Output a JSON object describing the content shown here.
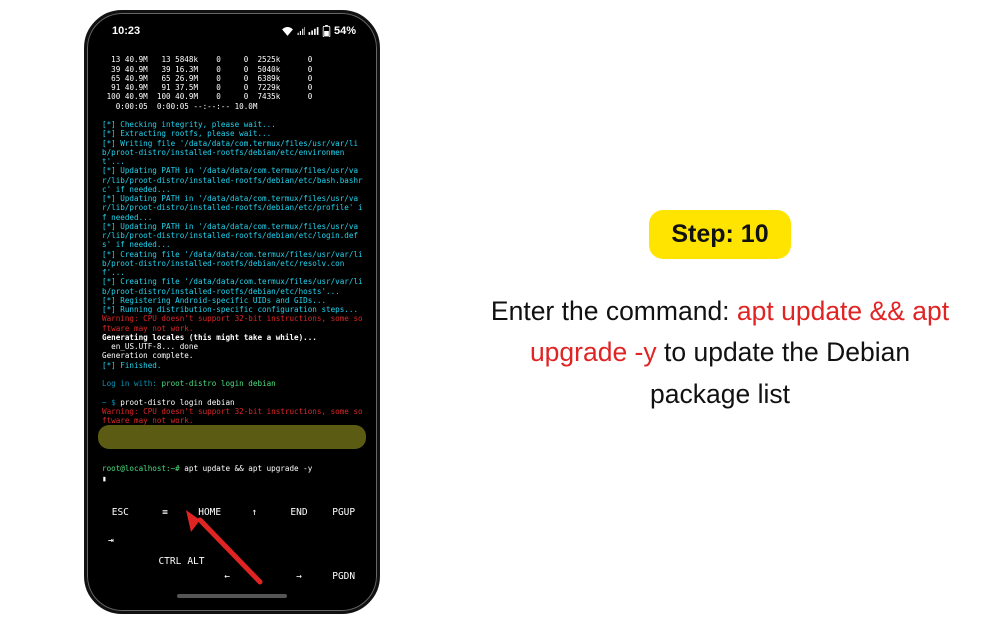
{
  "status": {
    "time": "10:23",
    "battery": "54%"
  },
  "terminal": {
    "table_rows": [
      "  13 40.9M   13 5848k    0     0  2525k      0",
      "  39 40.9M   39 16.3M    0     0  5040k      0",
      "  65 40.9M   65 26.9M    0     0  6389k      0",
      "  91 40.9M   91 37.5M    0     0  7229k      0",
      " 100 40.9M  100 40.9M    0     0  7435k      0",
      "   0:00:05  0:00:05 --:--:-- 10.0M"
    ],
    "cyan_block": "[*] Checking integrity, please wait...\n[*] Extracting rootfs, please wait...\n[*] Writing file '/data/data/com.termux/files/usr/var/lib/proot-distro/installed-rootfs/debian/etc/environment'...\n[*] Updating PATH in '/data/data/com.termux/files/usr/var/lib/proot-distro/installed-rootfs/debian/etc/bash.bashrc' if needed...\n[*] Updating PATH in '/data/data/com.termux/files/usr/var/lib/proot-distro/installed-rootfs/debian/etc/profile' if needed...\n[*] Updating PATH in '/data/data/com.termux/files/usr/var/lib/proot-distro/installed-rootfs/debian/etc/login.defs' if needed...\n[*] Creating file '/data/data/com.termux/files/usr/var/lib/proot-distro/installed-rootfs/debian/etc/resolv.conf'...\n[*] Creating file '/data/data/com.termux/files/usr/var/lib/proot-distro/installed-rootfs/debian/etc/hosts'...\n[*] Registering Android-specific UIDs and GIDs...\n[*] Running distribution-specific configuration steps...",
    "warn1": "Warning: CPU doesn't support 32-bit instructions, some software may not work.",
    "gen1": "Generating locales (this might take a while)...",
    "gen2": "  en_US.UTF-8... done",
    "gen3": "Generation complete.",
    "finished": "[*] Finished.",
    "login_line_pre": "Log in with: ",
    "login_line_cmd": "proot-distro login debian",
    "prompt1_pre": "~ $ ",
    "prompt1_cmd": "proot-distro login debian",
    "warn2": "Warning: CPU doesn't support 32-bit instructions, some software may not work.",
    "rootline_pre": "root@localhost:~# ",
    "rootline_cmd": "apt update && apt upgrade -y",
    "caret": "▮"
  },
  "softkeys": {
    "row1": [
      "ESC",
      "≡",
      "HOME",
      "↑",
      "END",
      "PGUP"
    ],
    "row2": [
      "⇥",
      "CTRL",
      "ALT",
      "←",
      "↓",
      "→",
      "PGDN"
    ]
  },
  "right": {
    "badge": "Step: 10",
    "desc_pre": "Enter the command: ",
    "desc_cmd": "apt update && apt upgrade -y",
    "desc_post": " to update the Debian package list"
  }
}
